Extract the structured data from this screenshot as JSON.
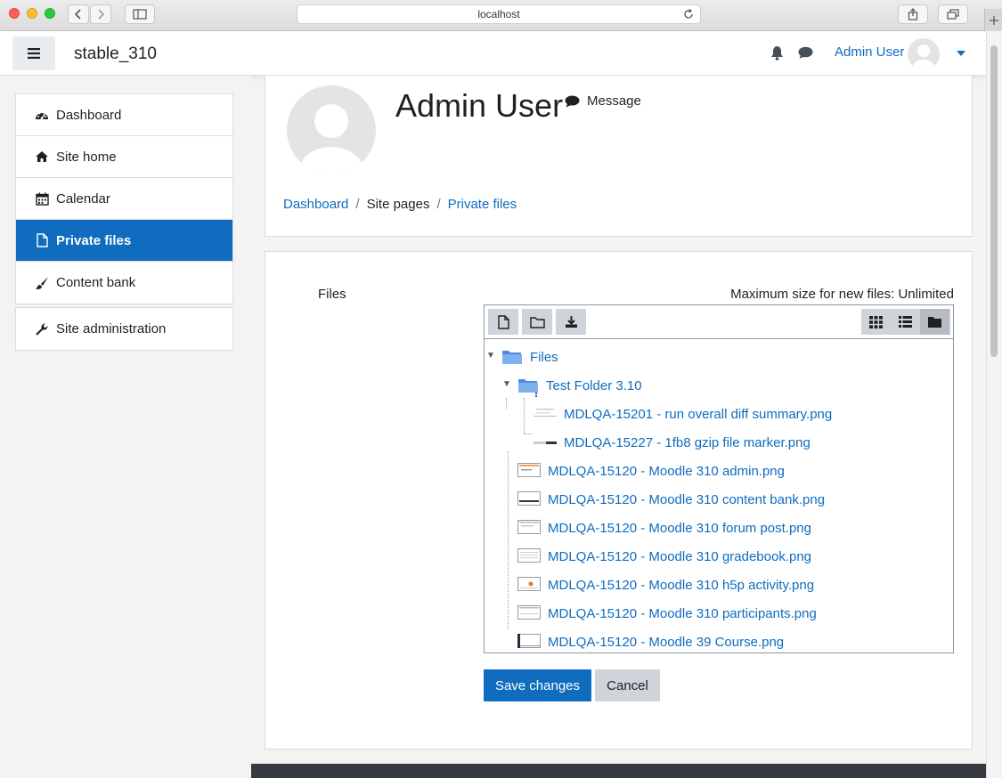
{
  "browser": {
    "url": "localhost"
  },
  "navbar": {
    "site_name": "stable_310",
    "user_name": "Admin User"
  },
  "sidebar": {
    "items": [
      {
        "label": "Dashboard",
        "icon": "dashboard-icon"
      },
      {
        "label": "Site home",
        "icon": "home-icon"
      },
      {
        "label": "Calendar",
        "icon": "calendar-icon"
      },
      {
        "label": "Private files",
        "icon": "file-icon",
        "active": true
      },
      {
        "label": "Content bank",
        "icon": "paintbrush-icon"
      }
    ],
    "admin": {
      "label": "Site administration",
      "icon": "wrench-icon"
    }
  },
  "profile": {
    "name": "Admin User",
    "message_label": "Message"
  },
  "breadcrumb": {
    "items": [
      "Dashboard",
      "Site pages",
      "Private files"
    ]
  },
  "form": {
    "files_label": "Files",
    "max_size": "Maximum size for new files: Unlimited",
    "save_label": "Save changes",
    "cancel_label": "Cancel"
  },
  "filemanager": {
    "root": "Files",
    "folder": "Test Folder 3.10",
    "folder_files": [
      "MDLQA-15201 - run overall diff summary.png",
      "MDLQA-15227 - 1fb8 gzip file marker.png"
    ],
    "root_files": [
      "MDLQA-15120 - Moodle 310 admin.png",
      "MDLQA-15120 - Moodle 310 content bank.png",
      "MDLQA-15120 - Moodle 310 forum post.png",
      "MDLQA-15120 - Moodle 310 gradebook.png",
      "MDLQA-15120 - Moodle 310 h5p activity.png",
      "MDLQA-15120 - Moodle 310 participants.png",
      "MDLQA-15120 - Moodle 39 Course.png"
    ]
  },
  "colors": {
    "primary": "#0f6cbf",
    "sidebar_bg": "#f3f3f3",
    "footer": "#343a40"
  }
}
